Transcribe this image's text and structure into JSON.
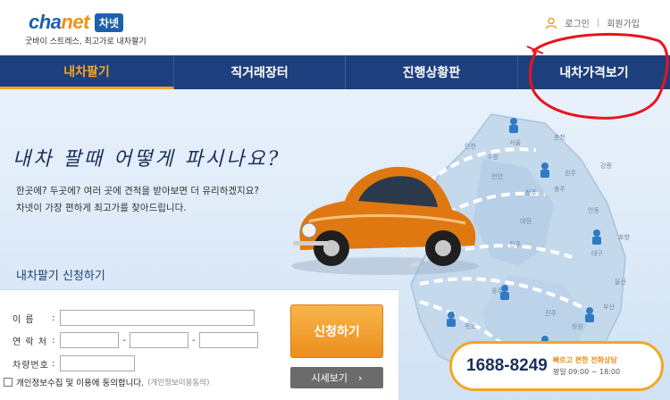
{
  "header": {
    "logo_en_a": "cha",
    "logo_en_b": "net",
    "logo_ko": "차넷",
    "tagline": "굿바이 스트레스, 최고가로 내차팔기",
    "login": "로그인",
    "separator": "|",
    "signup": "회원가입"
  },
  "nav": {
    "items": [
      {
        "label": "내차팔기",
        "active": true
      },
      {
        "label": "직거래장터",
        "active": false
      },
      {
        "label": "진행상황판",
        "active": false
      },
      {
        "label": "내차가격보기",
        "active": false
      }
    ]
  },
  "hero": {
    "question": "내차 팔때 어떻게 파시나요?",
    "desc_line1": "한곳에? 두곳에? 여러 곳에 견적을 받아보면 더 유리하겠지요?",
    "desc_line2": "차넷이 가장 편하게 최고가를 찾아드립니다."
  },
  "map_labels": [
    "서울",
    "춘천",
    "강릉",
    "원주",
    "청주",
    "충주",
    "대전",
    "안동",
    "포항",
    "대구",
    "울산",
    "부산",
    "광주",
    "전주",
    "목포",
    "창원",
    "진주",
    "천안",
    "수원",
    "인천"
  ],
  "form": {
    "title": "내차팔기 신청하기",
    "name_label": "이 름",
    "phone_label": "연 락 처",
    "carno_label": "차량번호",
    "colon": ":",
    "dash": "-",
    "agree_text": "개인정보수집 및 이용에 동의합니다.",
    "agree_link": "(개인정보이용동의)",
    "apply_button": "신청하기",
    "price_button": "시세보기",
    "price_arrow": "›"
  },
  "hotline": {
    "number": "1688-8249",
    "caption1": "빠르고 편한 전화상담",
    "caption2": "평일 09:00 ~ 18:00"
  },
  "colors": {
    "nav_bg": "#1d3f7d",
    "accent": "#f5a623",
    "annotation": "#e8141e"
  }
}
